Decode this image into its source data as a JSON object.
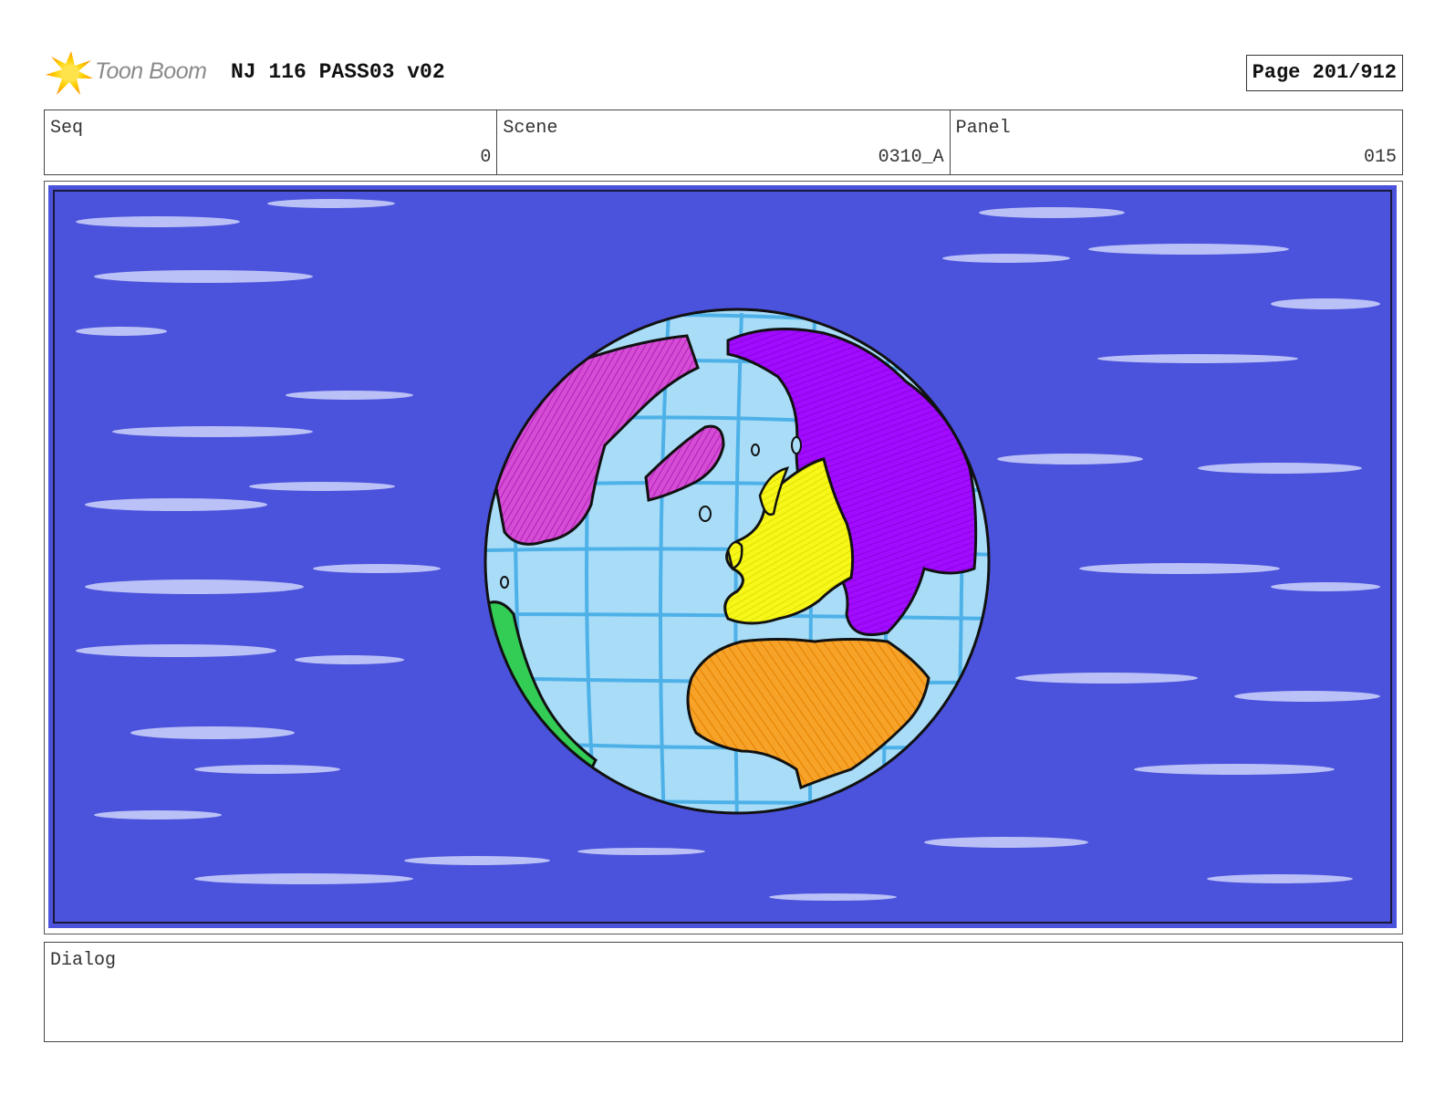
{
  "header": {
    "logo_text": "Toon Boom",
    "project_title": "NJ 116 PASS03 v02",
    "page_label": "Page 201/912"
  },
  "info": {
    "seq_label": "Seq",
    "seq_value": "0",
    "scene_label": "Scene",
    "scene_value": "0310_A",
    "panel_label": "Panel",
    "panel_value": "015"
  },
  "dialog": {
    "label": "Dialog",
    "text": ""
  },
  "colors": {
    "background": "#4b52dc",
    "ocean": "#a8dcf7",
    "grid": "#3eaae6",
    "north_america": "#cc33cc",
    "greenland": "#cc33cc",
    "asia": "#9a00ff",
    "europe": "#f5f500",
    "africa": "#f79e1b",
    "south_america": "#33cc55"
  },
  "icons": {
    "logo": "toon-boom-star-icon"
  }
}
